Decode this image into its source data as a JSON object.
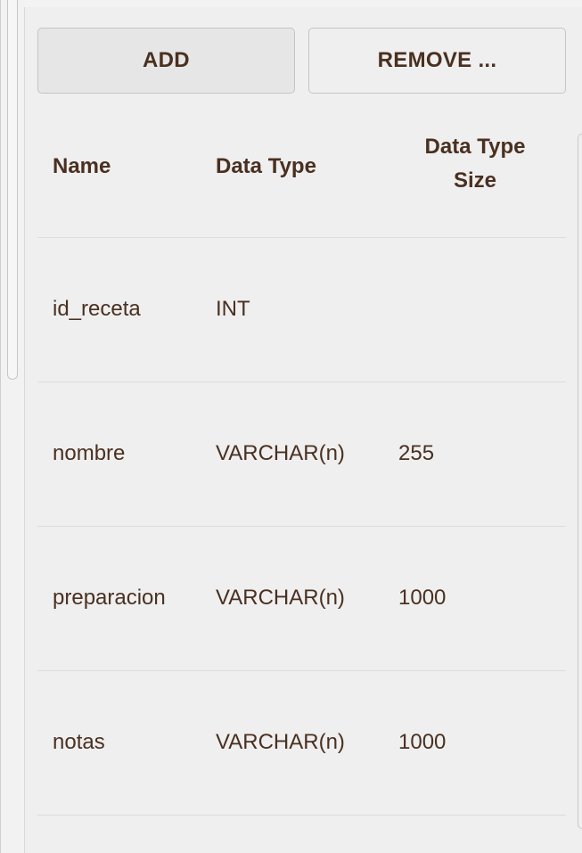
{
  "toolbar": {
    "add_label": "ADD",
    "remove_label": "REMOVE ..."
  },
  "table": {
    "headers": {
      "name": "Name",
      "data_type": "Data Type",
      "data_type_size_line1": "Data Type",
      "data_type_size_line2": "Size"
    },
    "rows": [
      {
        "name": "id_receta",
        "type": "INT",
        "size": ""
      },
      {
        "name": "nombre",
        "type": "VARCHAR(n)",
        "size": "255"
      },
      {
        "name": "preparacion",
        "type": "VARCHAR(n)",
        "size": "1000"
      },
      {
        "name": "notas",
        "type": "VARCHAR(n)",
        "size": "1000"
      }
    ]
  },
  "colors": {
    "text": "#4a3020",
    "background": "#efefef",
    "divider": "#dcdcdc"
  }
}
